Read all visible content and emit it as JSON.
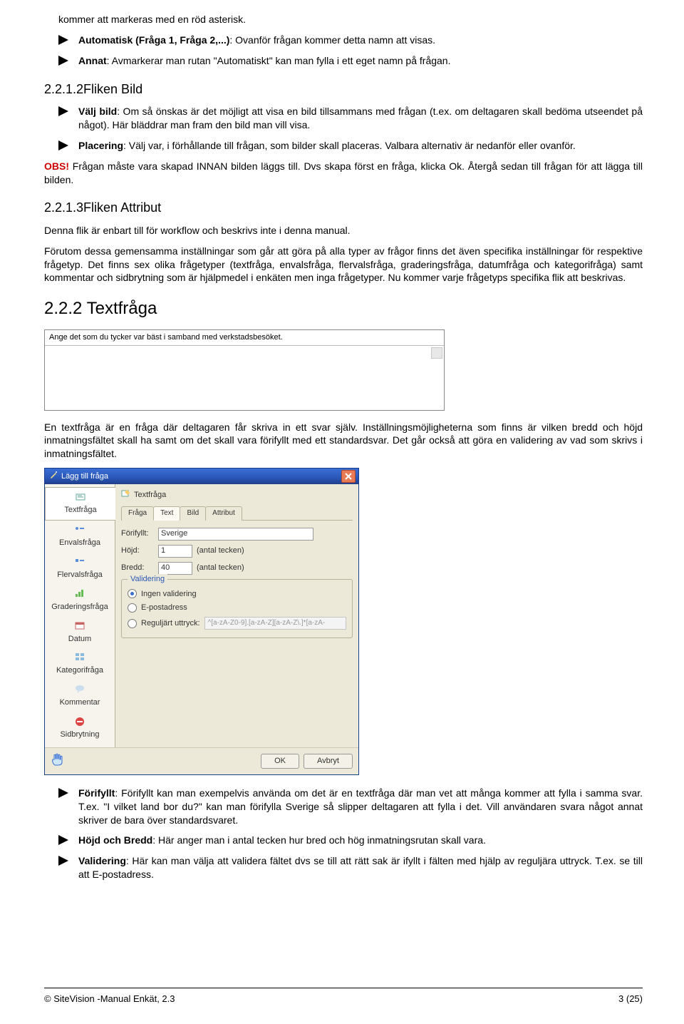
{
  "intro_line": "kommer att markeras med en röd asterisk.",
  "bullets_top": [
    {
      "bold": "Automatisk (Fråga 1, Fråga 2,...)",
      "rest": ": Ovanför frågan kommer detta namn att visas."
    },
    {
      "bold": "Annat",
      "rest": ": Avmarkerar man rutan \"Automatiskt\" kan man fylla i ett eget namn på frågan."
    }
  ],
  "sec1": {
    "heading": "2.2.1.2Fliken Bild",
    "b1": {
      "bold": "Välj bild",
      "rest": ": Om så önskas är det möjligt att visa en bild tillsammans med frågan (t.ex. om deltagaren skall bedöma utseendet på något). Här bläddrar man fram den bild man vill visa."
    },
    "b2": {
      "bold": "Placering",
      "rest": ": Välj var, i förhållande till frågan, som bilder skall placeras. Valbara alternativ är nedanför eller ovanför."
    },
    "obs_label": "OBS!",
    "obs_text": " Frågan måste vara skapad INNAN bilden läggs till. Dvs skapa först en fråga, klicka Ok. Återgå sedan till frågan för att lägga till bilden."
  },
  "sec2": {
    "heading": "2.2.1.3Fliken Attribut",
    "p1": "Denna flik är enbart till för workflow och beskrivs inte i denna manual.",
    "p2": "Förutom dessa gemensamma inställningar som går att göra på alla typer av frågor finns det även specifika inställningar för respektive frågetyp. Det finns sex olika frågetyper (textfråga, envalsfråga, flervalsfråga, graderingsfråga, datumfråga och kategorifråga) samt kommentar och sidbrytning som är hjälpmedel i enkäten men inga frågetyper. Nu kommer varje frågetyps specifika flik att beskrivas."
  },
  "sec3": {
    "heading": "2.2.2 Textfråga",
    "textq_label": "Ange det som du tycker var bäst i samband med verkstadsbesöket.",
    "p1": "En textfråga är en fråga där deltagaren får skriva in ett svar själv. Inställningsmöjligheterna som finns är vilken bredd och höjd inmatningsfältet skall ha samt om det skall vara förifyllt med ett standardsvar. Det  går också att göra en validering av vad som skrivs i inmatningsfältet."
  },
  "dialog": {
    "title": "Lägg till fråga",
    "panel_title": "Textfråga",
    "side": [
      "Textfråga",
      "Envalsfråga",
      "Flervalsfråga",
      "Graderingsfråga",
      "Datum",
      "Kategorifråga",
      "Kommentar",
      "Sidbrytning"
    ],
    "tabs": [
      "Fråga",
      "Text",
      "Bild",
      "Attribut"
    ],
    "rows": {
      "forifyllt_label": "Förifyllt:",
      "forifyllt_val": "Sverige",
      "hojd_label": "Höjd:",
      "hojd_val": "1",
      "hojd_unit": "(antal tecken)",
      "bredd_label": "Bredd:",
      "bredd_val": "40",
      "bredd_unit": "(antal tecken)"
    },
    "fieldset": {
      "legend": "Validering",
      "r1": "Ingen validering",
      "r2": "E-postadress",
      "r3": "Reguljärt uttryck:",
      "regex": "^[a-zA-Z0-9].[a-zA-Z][a-zA-Z\\.]*[a-zA-"
    },
    "ok": "OK",
    "cancel": "Avbryt"
  },
  "bullets_bottom": [
    {
      "bold": "Förifyllt",
      "rest": ": Förifyllt kan man exempelvis använda om det är en textfråga där man vet att många kommer att fylla i samma svar. T.ex. \"I vilket land bor du?\" kan man förifylla Sverige så slipper deltagaren att fylla i det. Vill användaren svara något annat skriver de bara över standardsvaret."
    },
    {
      "bold": "Höjd och Bredd",
      "rest": ": Här anger man i antal tecken hur bred och hög inmatningsrutan skall vara."
    },
    {
      "bold": "Validering",
      "rest": ":  Här kan man välja att validera fältet dvs se till att rätt sak är ifyllt i fälten med hjälp av reguljära uttryck. T.ex. se till att E-postadress."
    }
  ],
  "footer": {
    "left": "© SiteVision -Manual Enkät, 2.3",
    "right": "3 (25)"
  }
}
